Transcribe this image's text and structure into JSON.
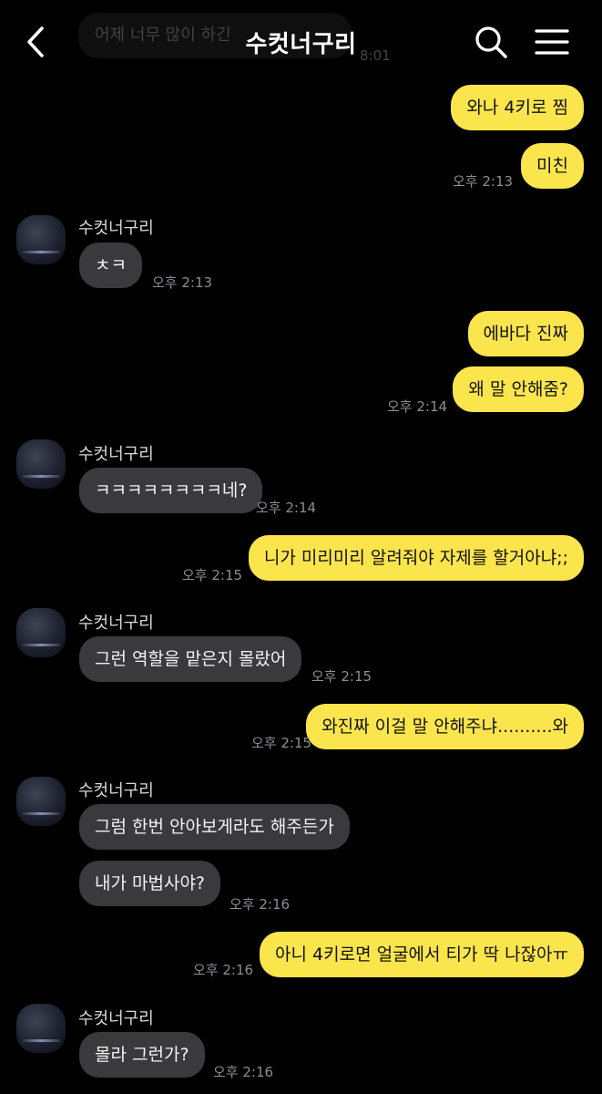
{
  "header": {
    "title": "수컷너구리",
    "ghost_text": "어제 너무 많이 하긴",
    "ghost_time": "8:01"
  },
  "icons": {
    "back": "back-chevron-icon",
    "search": "search-icon",
    "menu": "menu-icon"
  },
  "colors": {
    "my_bubble": "#fbe54d",
    "their_bubble": "#3a3a3c",
    "background": "#000000"
  },
  "messages": [
    {
      "from": "me",
      "text": "와나 4키로 찜"
    },
    {
      "from": "me",
      "text": "미친",
      "time": "오후 2:13"
    },
    {
      "from": "them",
      "sender": "수컷너구리",
      "text": "ㅊㅋ",
      "time": "오후 2:13"
    },
    {
      "from": "me",
      "text": "에바다 진짜"
    },
    {
      "from": "me",
      "text": "왜 말 안해줌?",
      "time": "오후 2:14"
    },
    {
      "from": "them",
      "sender": "수컷너구리",
      "text": "ㅋㅋㅋㅋㅋㅋㅋㅋ네?",
      "time": "오후 2:14"
    },
    {
      "from": "me",
      "text": "니가 미리미리 알려줘야 자제를 할거아냐;;",
      "time": "오후 2:15"
    },
    {
      "from": "them",
      "sender": "수컷너구리",
      "text": "그런 역할을 맡은지 몰랐어",
      "time": "오후 2:15"
    },
    {
      "from": "me",
      "text": "와진짜 이걸 말 안해주냐..........와",
      "time": "오후 2:15"
    },
    {
      "from": "them",
      "sender": "수컷너구리",
      "text": "그럼 한번 안아보게라도 해주든가"
    },
    {
      "from": "them",
      "text": "내가 마법사야?",
      "time": "오후 2:16"
    },
    {
      "from": "me",
      "text": "아니 4키로면 얼굴에서 티가 딱 나잖아ㅠ",
      "time": "오후 2:16"
    },
    {
      "from": "them",
      "sender": "수컷너구리",
      "text": "몰라 그런가?",
      "time": "오후 2:16"
    }
  ]
}
